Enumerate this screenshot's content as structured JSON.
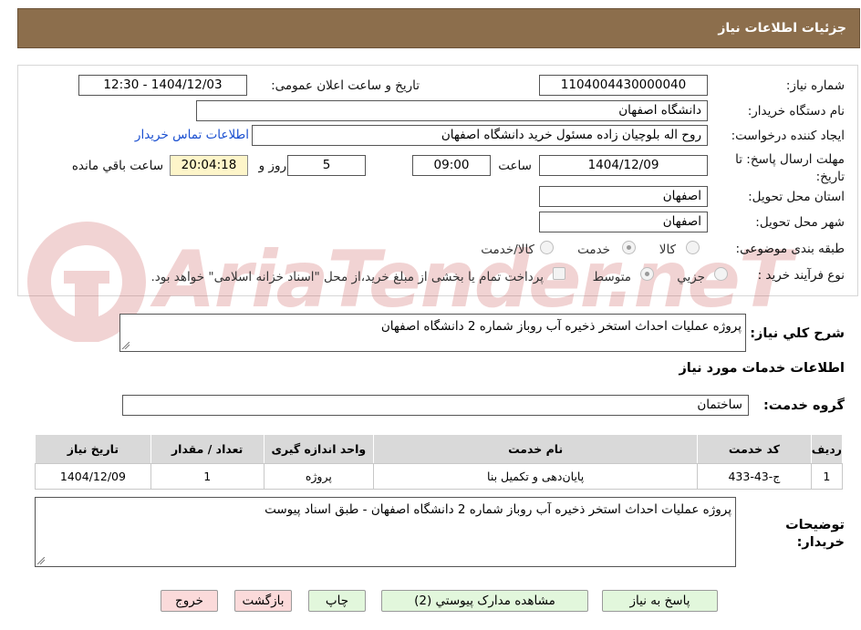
{
  "header": {
    "title": "جزئیات اطلاعات نیاز"
  },
  "form": {
    "need_number_label": "شماره نیاز:",
    "need_number": "1104004430000040",
    "announce_label": "تاریخ و ساعت اعلان عمومی:",
    "announce_value": "1404/12/03 - 12:30",
    "buyer_org_label": "نام دستگاه خریدار:",
    "buyer_org": "دانشگاه اصفهان",
    "requester_label": "ایجاد کننده درخواست:",
    "requester": "روح اله بلوچیان زاده مسئول خرید دانشگاه اصفهان",
    "contact_link": "اطلاعات تماس خریدار",
    "deadline_label": "مهلت ارسال پاسخ: تا تاریخ:",
    "deadline_date": "1404/12/09",
    "time_label": "ساعت",
    "deadline_time": "09:00",
    "days_value": "5",
    "days_label": "روز و",
    "remaining_time": "20:04:18",
    "remaining_label": "ساعت باقي مانده",
    "province_label": "استان محل تحویل:",
    "province": "اصفهان",
    "city_label": "شهر محل تحویل:",
    "city": "اصفهان",
    "category_label": "طبقه بندی موضوعی:",
    "category_options": [
      "کالا",
      "خدمت",
      "کالا/خدمت"
    ],
    "category_selected": "خدمت",
    "process_label": "نوع فرآیند خرید :",
    "process_options": [
      "جزيي",
      "متوسط"
    ],
    "process_selected": "متوسط",
    "treasury_note": "پرداخت تمام یا بخشی از مبلغ خرید،از محل \"اسناد خزانه اسلامی\" خواهد بود."
  },
  "summary": {
    "label": "شرح کلي نیاز:",
    "text": "پروژه عملیات احداث استخر ذخیره آب روباز شماره 2 دانشگاه اصفهان"
  },
  "services_section": {
    "title": "اطلاعات خدمات مورد نیاز",
    "group_label": "گروه خدمت:",
    "group_value": "ساختمان"
  },
  "table": {
    "headers": [
      "ردیف",
      "کد خدمت",
      "نام خدمت",
      "واحد اندازه گیری",
      "تعداد / مقدار",
      "تاریخ نیاز"
    ],
    "rows": [
      [
        "1",
        "ج-43-433",
        "پایان‌دهی و تکمیل بنا",
        "پروژه",
        "1",
        "1404/12/09"
      ]
    ]
  },
  "buyer_notes": {
    "label": "توضیحات خریدار:",
    "text": "پروژه عملیات احداث استخر ذخیره آب روباز شماره 2 دانشگاه اصفهان - طبق اسناد پیوست"
  },
  "buttons": {
    "respond": "پاسخ به نیاز",
    "attachments": "مشاهده مدارک پیوستي (2)",
    "print": "چاپ",
    "back": "بازگشت",
    "exit": "خروج"
  },
  "watermark": {
    "text": "AriaTender.neT"
  },
  "colors": {
    "header": "#8c6e4c",
    "link": "#1a4fd0",
    "button_green": "#e2f7dc",
    "button_pink": "#fbdada",
    "remaining_bg": "#fdf5c9"
  }
}
